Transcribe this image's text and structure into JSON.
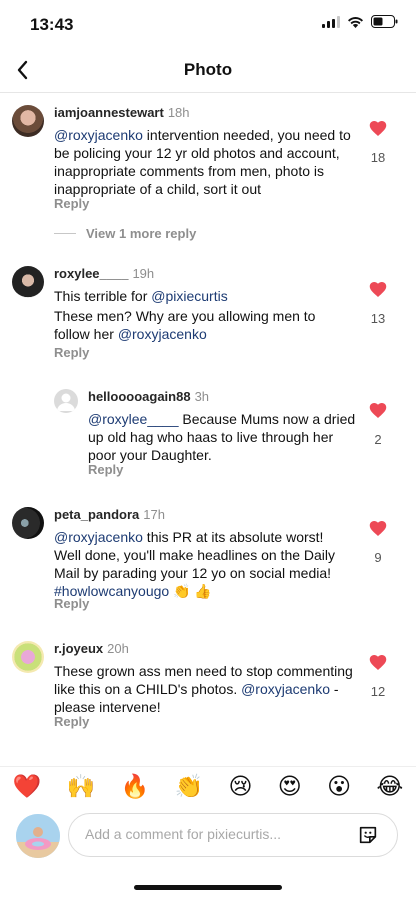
{
  "status": {
    "time": "13:43"
  },
  "header": {
    "title": "Photo"
  },
  "comments": [
    {
      "user": "iamjoannestewart",
      "time": "18h",
      "mention": "@roxyjacenko",
      "text": " intervention needed, you need to be policing your 12 yr old photos and account, inappropriate comments from men, photo is inappropriate of a child, sort it out",
      "likes": "18",
      "reply": "Reply"
    },
    {
      "user": "roxylee____",
      "time": "19h",
      "line1": "This terrible for ",
      "mention1": "@pixiecurtis",
      "line2": "These men? Why are you allowing men to follow her ",
      "mention2": "@roxyjacenko",
      "likes": "13",
      "reply": "Reply"
    },
    {
      "user": "hellooooagain88",
      "time": "3h",
      "mention": "@roxylee____",
      "text": " Because Mums now a dried up old hag who haas to live through her poor your Daughter.",
      "likes": "2",
      "reply": "Reply"
    },
    {
      "user": "peta_pandora",
      "time": "17h",
      "mention": "@roxyjacenko",
      "text": " this PR at its absolute worst! Well done, you'll make headlines on the Daily Mail by parading your 12 yo on social media! ",
      "hashtag": "#howlowcanyougo",
      "emoji": " 👏 👍",
      "likes": "9",
      "reply": "Reply"
    },
    {
      "user": "r.joyeux",
      "time": "20h",
      "text": "These grown ass men need to stop commenting like this on a CHILD's photos. ",
      "mention": "@roxyjacenko",
      "text2": " - please intervene!",
      "likes": "12",
      "reply": "Reply"
    }
  ],
  "view_more": "View 1 more reply",
  "emojis": [
    "❤️",
    "🙌",
    "🔥",
    "👏",
    "😢",
    "😍",
    "😮",
    "😂"
  ],
  "composer": {
    "placeholder": "Add a comment for pixiecurtis..."
  },
  "colors": {
    "heart": "#ed4956",
    "mention": "#1d3b73"
  }
}
